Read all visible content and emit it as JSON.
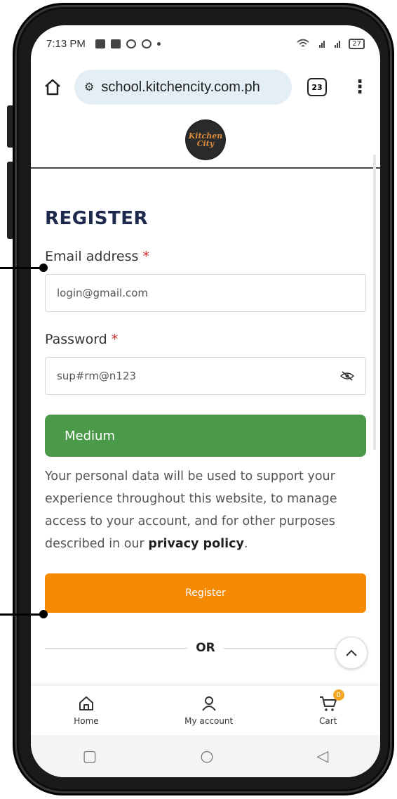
{
  "status_bar": {
    "time": "7:13 PM",
    "battery": "27"
  },
  "browser": {
    "url": "school.kitchencity.com.ph",
    "tab_count": "23"
  },
  "site": {
    "logo_text": "Kitchen City"
  },
  "form": {
    "title": "REGISTER",
    "email_label": "Email address",
    "email_value": "login@gmail.com",
    "password_label": "Password",
    "password_value": "sup#rm@n123",
    "required_mark": "*",
    "strength": "Medium",
    "privacy_text": "Your personal data will be used to support your experience throughout this website, to manage access to your account, and for other purposes described in our",
    "privacy_link": "privacy policy",
    "privacy_end": ".",
    "register_label": "Register",
    "or_label": "OR"
  },
  "bottom_nav": {
    "home": "Home",
    "account": "My account",
    "cart": "Cart",
    "cart_count": "0"
  },
  "colors": {
    "strength_green": "#4a9a4a",
    "register_orange": "#f58a07",
    "title_navy": "#1d2a4d"
  }
}
